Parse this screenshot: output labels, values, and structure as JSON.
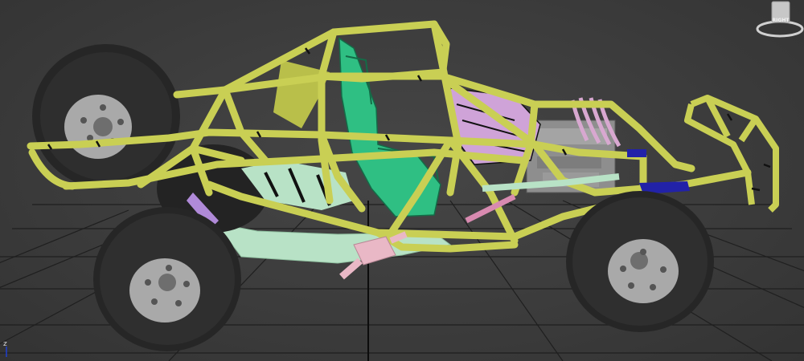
{
  "viewport": {
    "background": "#3b3b3b",
    "grid_color": "#1e1e1e",
    "grid_axis_color": "#0f0f0f"
  },
  "model": {
    "frame_color": "#c9cf54",
    "tire_color": "#262626",
    "rim_color": "#a9a9a9",
    "seat_color": "#2fbf83",
    "panel_color": "#cfa3d8",
    "floor_color": "#b8e2c6",
    "exhaust_color": "#e9b8c6",
    "bracket_color": "#2222a8",
    "engine_color": "#9a9a9a"
  },
  "viewcube": {
    "face_label": "RIGHT"
  },
  "axis": {
    "label": "z"
  }
}
